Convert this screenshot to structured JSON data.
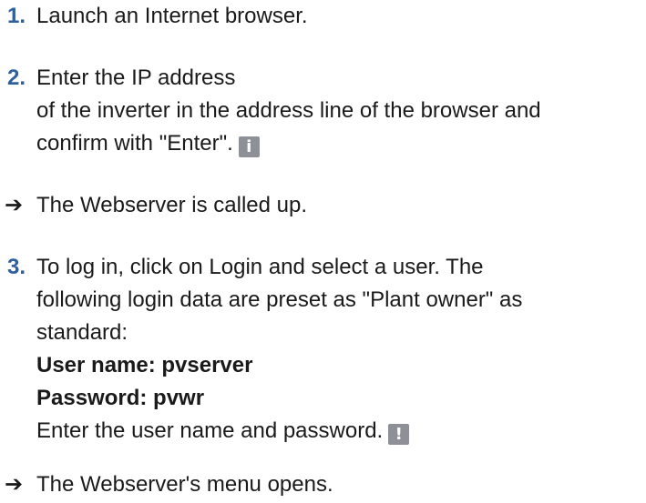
{
  "steps": [
    {
      "number": "1.",
      "lines": [
        "Launch an Internet browser."
      ]
    },
    {
      "number": "2.",
      "lines": [
        "Enter the IP address",
        "of the inverter in the address line of the browser and",
        "confirm with \"Enter\"."
      ],
      "badge": "i",
      "badge_icon": "info-icon"
    },
    {
      "result": "The Webserver is called up."
    },
    {
      "number": "3.",
      "lines": [
        "To log in, click on Login and select a user. The",
        "following login data are preset as \"Plant owner\" as",
        "standard:"
      ],
      "bold_lines": [
        "User name: pvserver",
        "Password: pvwr"
      ],
      "final_line": "Enter the user name and password.",
      "badge": "!",
      "badge_icon": "warning-icon"
    },
    {
      "result": "The Webserver's menu opens."
    }
  ],
  "colors": {
    "step_number": "#2e5f9e",
    "badge_bg": "#8d9097",
    "text": "#1a1a1a"
  }
}
